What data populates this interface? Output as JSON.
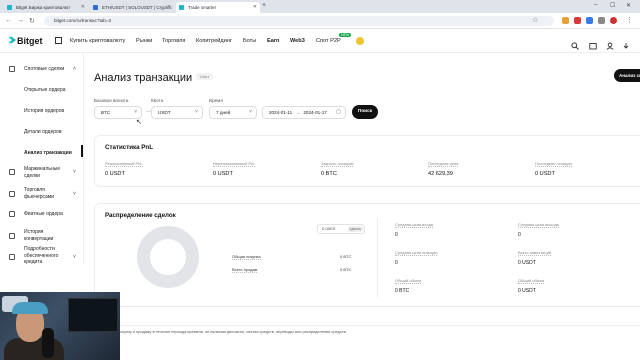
{
  "browser": {
    "tabs": [
      {
        "title": "Bitget Биржа криптовалют",
        "fav": "#20b6c9",
        "active": false
      },
      {
        "title": "ETH/USDT | SOLOUSDT | Cryptoc",
        "fav": "#2a6fdb",
        "active": false
      },
      {
        "title": "Trade smarter",
        "fav": "#20b6c9",
        "active": true
      }
    ],
    "new_tab": "+",
    "url": "bitget.com/ru/transac?tab=3",
    "window_controls": [
      "–",
      "☐",
      "✕"
    ]
  },
  "header": {
    "logo": "Bitget",
    "menu": [
      {
        "label": "Купить криптовалюту",
        "bold": false
      },
      {
        "label": "Рынки",
        "bold": false
      },
      {
        "label": "Торговля",
        "bold": false
      },
      {
        "label": "Копитрейдинг",
        "bold": false
      },
      {
        "label": "Боты",
        "bold": false
      },
      {
        "label": "Earn",
        "bold": true
      },
      {
        "label": "Web3",
        "bold": true
      },
      {
        "label": "Спот P2P",
        "bold": false
      }
    ],
    "new_badge": "NEW"
  },
  "sidebar": {
    "group": "Спотовые сделки",
    "items": [
      {
        "label": "Открытые ордера"
      },
      {
        "label": "История ордеров"
      },
      {
        "label": "Детали ордеров"
      },
      {
        "label": "Анализ транзакции",
        "active": true
      }
    ],
    "sections": [
      {
        "label": "Маржинальные сделки"
      },
      {
        "label": "Торговля фьючерсами"
      },
      {
        "label": "Фиатные ордера"
      },
      {
        "label": "История конвертации"
      },
      {
        "label": "Подробности обеспеченного кредита"
      }
    ]
  },
  "page": {
    "title": "Анализ транзакции",
    "title_pill": "Спот",
    "top_button": "Анализ сп",
    "filters": {
      "base_label": "Базовая валюта",
      "base_value": "BTC",
      "quote_label": "Квота",
      "quote_value": "USDT",
      "time_label": "Время",
      "time_value": "7 дней",
      "date_from": "2024-01-11",
      "date_sep": "→",
      "date_to": "2024-01-17",
      "search": "Поиск"
    },
    "pnl": {
      "title": "Статистика PnL",
      "stats": [
        {
          "label": "Реализованный PnL",
          "value": "0 USDT"
        },
        {
          "label": "Нереализованный PnL",
          "value": "0 USDT"
        },
        {
          "label": "Закрыть позицию",
          "value": "0 BTC"
        },
        {
          "label": "Последняя цена",
          "value": "42 629,39"
        },
        {
          "label": "Последняя позиция",
          "value": "0 USDT"
        }
      ]
    },
    "distribution": {
      "title": "Распределение сделок",
      "select_value": "0,0AEK",
      "select_tag": "сделок",
      "legend": [
        {
          "label": "Общая покупка",
          "value": "0 BTC"
        },
        {
          "label": "Всего продаж",
          "value": "0 BTC"
        }
      ],
      "stats": [
        {
          "label": "Средняя цена входа",
          "value": "0"
        },
        {
          "label": "Средняя цена выхода",
          "value": "0"
        },
        {
          "label": "Средняя цена позиции",
          "value": "0"
        },
        {
          "label": "Всего инвестиций",
          "value": "0 USDT"
        },
        {
          "label": "Общий объем",
          "value": "0 BTC"
        },
        {
          "label": "Общий объем",
          "value": "0 USDT"
        }
      ]
    },
    "footer_note": "покупку и продажу в течение периода времени, не включая депозиты, снятия средств, переводы или распределение средств."
  }
}
